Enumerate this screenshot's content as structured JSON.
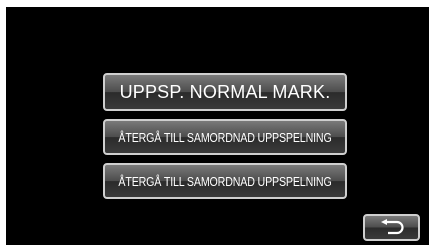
{
  "menu": {
    "items": [
      {
        "label": "UPPSP. NORMAL MARK."
      },
      {
        "label": "ÅTERGÅ TILL SAMORDNAD UPPSPELNING"
      },
      {
        "label": "ÅTERGÅ TILL SAMORDNAD UPPSPELNING"
      }
    ]
  },
  "back_button": {
    "icon": "return-arrow-icon"
  },
  "colors": {
    "screen_background": "#000000",
    "button_border": "#cfcfcf",
    "button_text": "#ffffff"
  }
}
